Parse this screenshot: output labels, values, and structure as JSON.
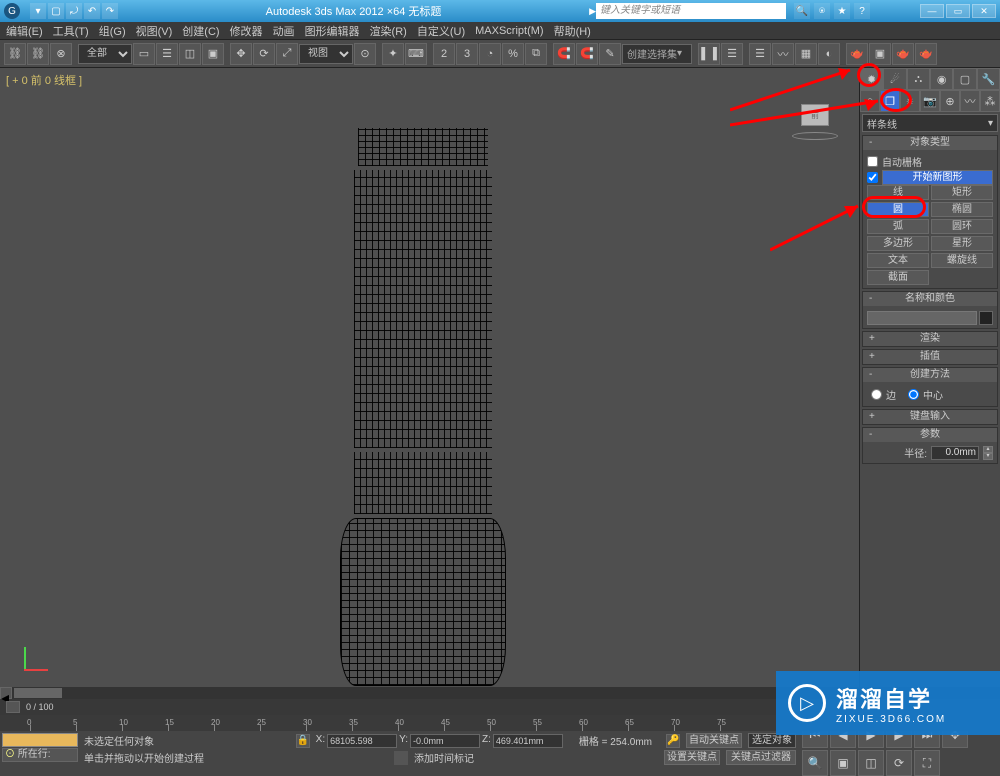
{
  "titlebar": {
    "title": "Autodesk 3ds Max 2012 ×64   无标题",
    "search_placeholder": "键入关键字或短语"
  },
  "menu": {
    "items": [
      "编辑(E)",
      "工具(T)",
      "组(G)",
      "视图(V)",
      "创建(C)",
      "修改器",
      "动画",
      "图形编辑器",
      "渲染(R)",
      "自定义(U)",
      "MAXScript(M)",
      "帮助(H)"
    ]
  },
  "toolbar": {
    "selset": "全部",
    "viewsel": "视图",
    "named_sel": "创建选择集"
  },
  "viewport": {
    "label": "[ + 0 前 0 线框 ]"
  },
  "cmdpanel": {
    "dropdown": "样条线",
    "obj_type_title": "对象类型",
    "autogrid": "自动栅格",
    "startnew": "开始新图形",
    "buttons": [
      {
        "label": "线",
        "sel": false
      },
      {
        "label": "矩形",
        "sel": false
      },
      {
        "label": "圆",
        "sel": true
      },
      {
        "label": "椭圆",
        "sel": false
      },
      {
        "label": "弧",
        "sel": false
      },
      {
        "label": "圆环",
        "sel": false
      },
      {
        "label": "多边形",
        "sel": false
      },
      {
        "label": "星形",
        "sel": false
      },
      {
        "label": "文本",
        "sel": false
      },
      {
        "label": "螺旋线",
        "sel": false
      },
      {
        "label": "截面",
        "sel": false
      }
    ],
    "name_color_title": "名称和颜色",
    "render_title": "渲染",
    "interp_title": "插值",
    "method_title": "创建方法",
    "method_edge": "边",
    "method_center": "中心",
    "kbd_title": "键盘输入",
    "params_title": "参数",
    "radius_label": "半径:",
    "radius_value": "0.0mm"
  },
  "status": {
    "frame_range": "0 / 100",
    "now_row": "所在行:",
    "add_marker": "添加时间标记",
    "no_sel": "未选定任何对象",
    "hint": "单击并拖动以开始创建过程",
    "x": "68105.598",
    "y": "-0.0mm",
    "z": "469.401mm",
    "grid": "栅格 = 254.0mm",
    "autokey": "自动关键点",
    "selkey": "选定对象",
    "setkey": "设置关键点",
    "filter": "关键点过滤器"
  },
  "watermark": {
    "t1": "溜溜自学",
    "t2": "ZIXUE.3D66.COM"
  },
  "ruler_ticks": [
    0,
    5,
    10,
    15,
    20,
    25,
    30,
    35,
    40,
    45,
    50,
    55,
    60,
    65,
    70,
    75
  ]
}
